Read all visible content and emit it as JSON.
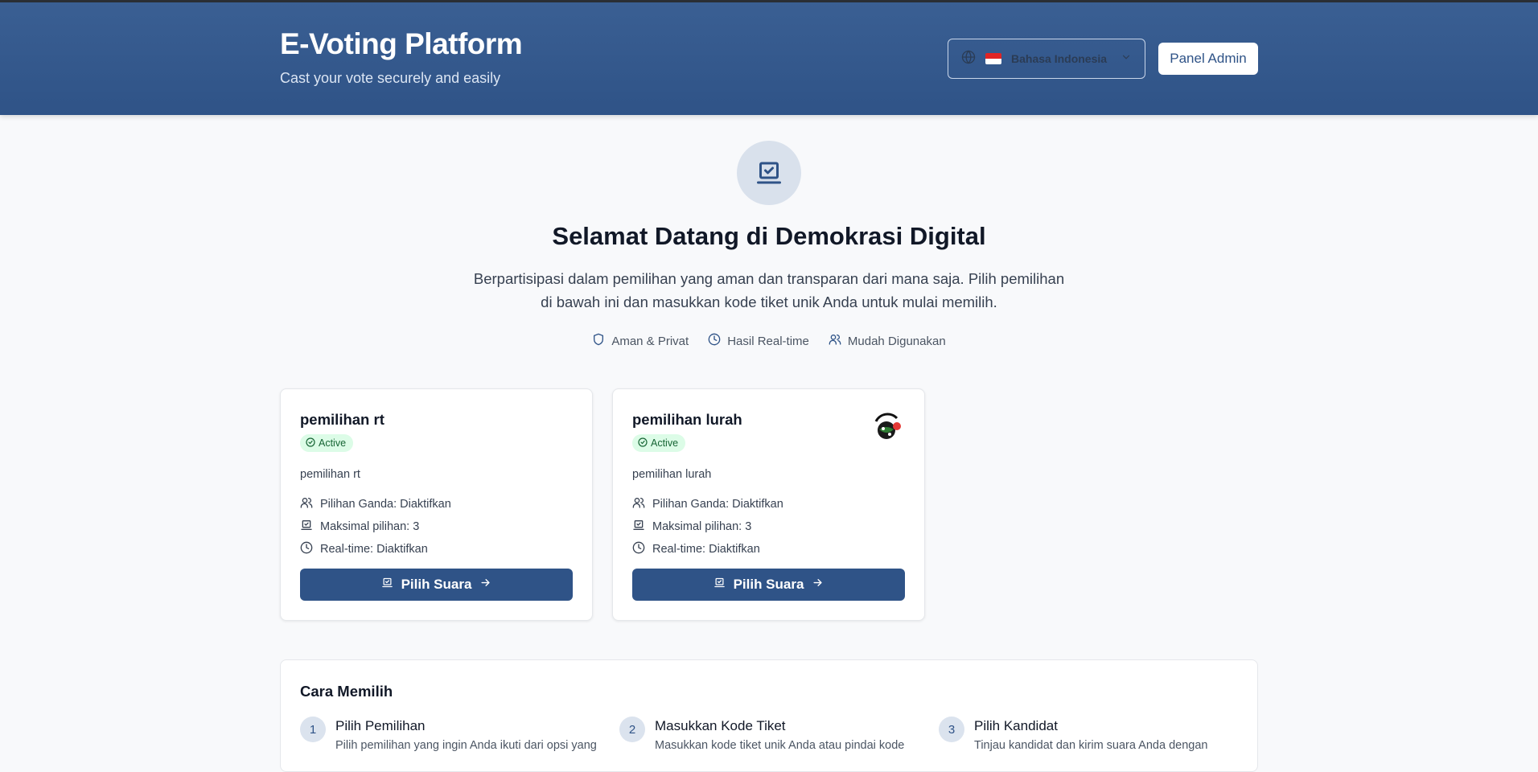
{
  "header": {
    "title": "E-Voting Platform",
    "subtitle": "Cast your vote securely and easily",
    "language": {
      "selected": "Bahasa Indonesia",
      "icon": "globe-icon",
      "flag": "indonesia-flag"
    },
    "admin_button": "Panel Admin"
  },
  "hero": {
    "icon": "vote-box-icon",
    "title": "Selamat Datang di Demokrasi Digital",
    "description": "Berpartisipasi dalam pemilihan yang aman dan transparan dari mana saja. Pilih pemilihan di bawah ini dan masukkan kode tiket unik Anda untuk mulai memilih.",
    "features": [
      {
        "icon": "shield-icon",
        "label": "Aman & Privat"
      },
      {
        "icon": "clock-icon",
        "label": "Hasil Real-time"
      },
      {
        "icon": "users-icon",
        "label": "Mudah Digunakan"
      }
    ]
  },
  "elections": [
    {
      "title": "pemilihan rt",
      "status": "Active",
      "description": "pemilihan rt",
      "multiple_choice": "Pilihan Ganda: Diaktifkan",
      "max_choices": "Maksimal pilihan: 3",
      "realtime": "Real-time: Diaktifkan",
      "button": "Pilih Suara",
      "has_logo": false
    },
    {
      "title": "pemilihan lurah",
      "status": "Active",
      "description": "pemilihan lurah",
      "multiple_choice": "Pilihan Ganda: Diaktifkan",
      "max_choices": "Maksimal pilihan: 3",
      "realtime": "Real-time: Diaktifkan",
      "button": "Pilih Suara",
      "has_logo": true
    }
  ],
  "howto": {
    "title": "Cara Memilih",
    "steps": [
      {
        "num": "1",
        "title": "Pilih Pemilihan",
        "desc": "Pilih pemilihan yang ingin Anda ikuti dari opsi yang"
      },
      {
        "num": "2",
        "title": "Masukkan Kode Tiket",
        "desc": "Masukkan kode tiket unik Anda atau pindai kode"
      },
      {
        "num": "3",
        "title": "Pilih Kandidat",
        "desc": "Tinjau kandidat dan kirim suara Anda dengan"
      }
    ]
  },
  "colors": {
    "primary": "#2f5387",
    "header_bg": "#3a5f93",
    "active_badge_bg": "#dcfce7",
    "active_badge_text": "#166534"
  }
}
